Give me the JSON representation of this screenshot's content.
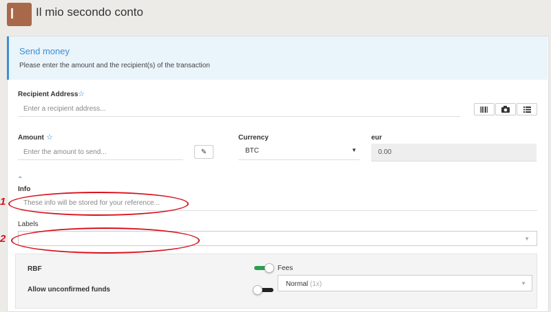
{
  "wallet": {
    "title": "Il mio secondo conto"
  },
  "callout": {
    "title": "Send money",
    "text": "Please enter the amount and the recipient(s) of the transaction"
  },
  "recipient": {
    "label": "Recipient Address",
    "placeholder": "Enter a recipient address..."
  },
  "amount": {
    "label": "Amount",
    "placeholder": "Enter the amount to send..."
  },
  "currency": {
    "label": "Currency",
    "selected": "BTC"
  },
  "fiat": {
    "label": "eur",
    "value": "0.00"
  },
  "info": {
    "label": "Info",
    "placeholder": "These info will be stored for your reference..."
  },
  "labels": {
    "label": "Labels"
  },
  "options": {
    "rbf_label": "RBF",
    "rbf_on": true,
    "fees_label": "Fees",
    "unconfirmed_label": "Allow unconfirmed funds",
    "unconfirmed_on": false,
    "fee_selected": "Normal",
    "fee_multiplier": "(1x)"
  },
  "annotations": {
    "marker_1": "1",
    "marker_2": "2"
  },
  "colors": {
    "accent": "#3b8fd4",
    "annotation": "#d8101b",
    "toggle_on": "#2e9e4f"
  }
}
